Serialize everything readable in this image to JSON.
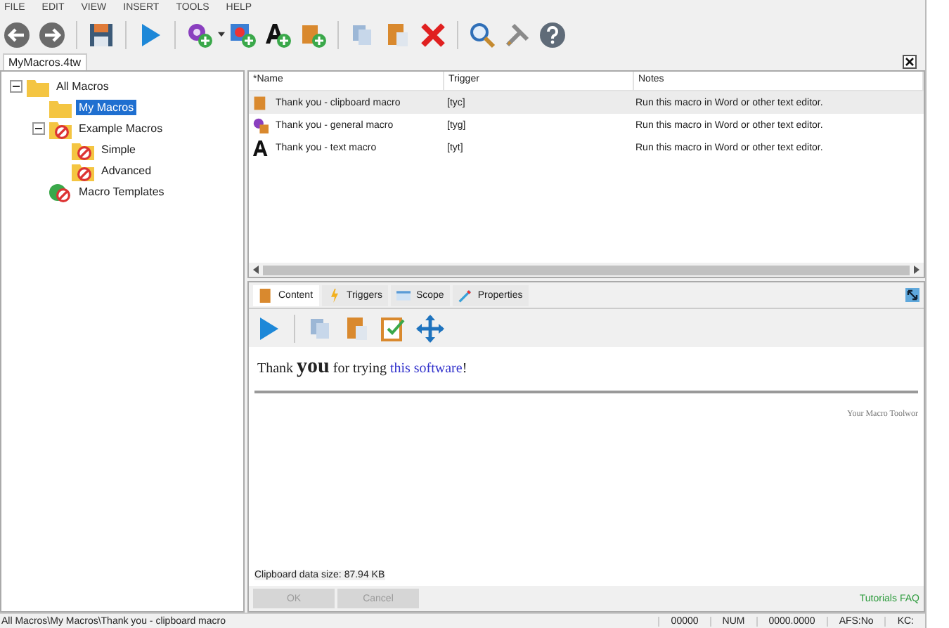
{
  "menu": [
    "FILE",
    "EDIT",
    "VIEW",
    "INSERT",
    "TOOLS",
    "HELP"
  ],
  "document_tab": {
    "label": "MyMacros.4tw",
    "selected": true
  },
  "tree": [
    {
      "label": "All Macros",
      "kind": "folder",
      "selected": false,
      "expanded": true,
      "children": [
        {
          "label": "My Macros",
          "kind": "folder",
          "selected": true
        },
        {
          "label": "Example Macros",
          "kind": "folder-blocked",
          "selected": false,
          "expanded": true,
          "children": [
            {
              "label": "Simple",
              "kind": "folder-blocked",
              "selected": false
            },
            {
              "label": "Advanced",
              "kind": "folder-blocked",
              "selected": false
            }
          ]
        },
        {
          "label": "Macro Templates",
          "kind": "template-blocked",
          "selected": false
        }
      ]
    }
  ],
  "table": {
    "columns": [
      "*Name",
      "Trigger",
      "Notes"
    ],
    "rows": [
      {
        "kind": "clipboard",
        "name": "Thank you - clipboard macro",
        "trigger": "[tyc]",
        "notes": "Run this macro in Word or other text editor.",
        "selected": true
      },
      {
        "kind": "general",
        "name": "Thank you - general macro",
        "trigger": "[tyg]",
        "notes": "Run this macro in Word or other text editor.",
        "selected": false
      },
      {
        "kind": "text",
        "name": "Thank you - text macro",
        "trigger": "[tyt]",
        "notes": "Run this macro in Word or other text editor.",
        "selected": false
      }
    ]
  },
  "detail_tabs": [
    {
      "label": "Content",
      "kind": "clipboard",
      "selected": true
    },
    {
      "label": "Triggers",
      "kind": "lightning",
      "selected": false
    },
    {
      "label": "Scope",
      "kind": "scope",
      "selected": false
    },
    {
      "label": "Properties",
      "kind": "properties",
      "selected": false
    }
  ],
  "message": {
    "lead": "Thank",
    "emphasis": "you",
    "middle": "for trying",
    "link": "this software",
    "tail": "!"
  },
  "signature": "Your Macro Toolwor",
  "clipboard_size": "Clipboard data size: 87.94 KB",
  "buttons": [
    {
      "label": "OK",
      "disabled": true
    },
    {
      "label": "Cancel",
      "disabled": true
    }
  ],
  "links": [
    "Tutorials",
    "FAQ"
  ],
  "status_bar": [
    "All Macros\\My Macros\\Thank you - clipboard macro",
    "00000",
    "NUM",
    "0000.0000",
    "AFS:No",
    "KC:"
  ]
}
